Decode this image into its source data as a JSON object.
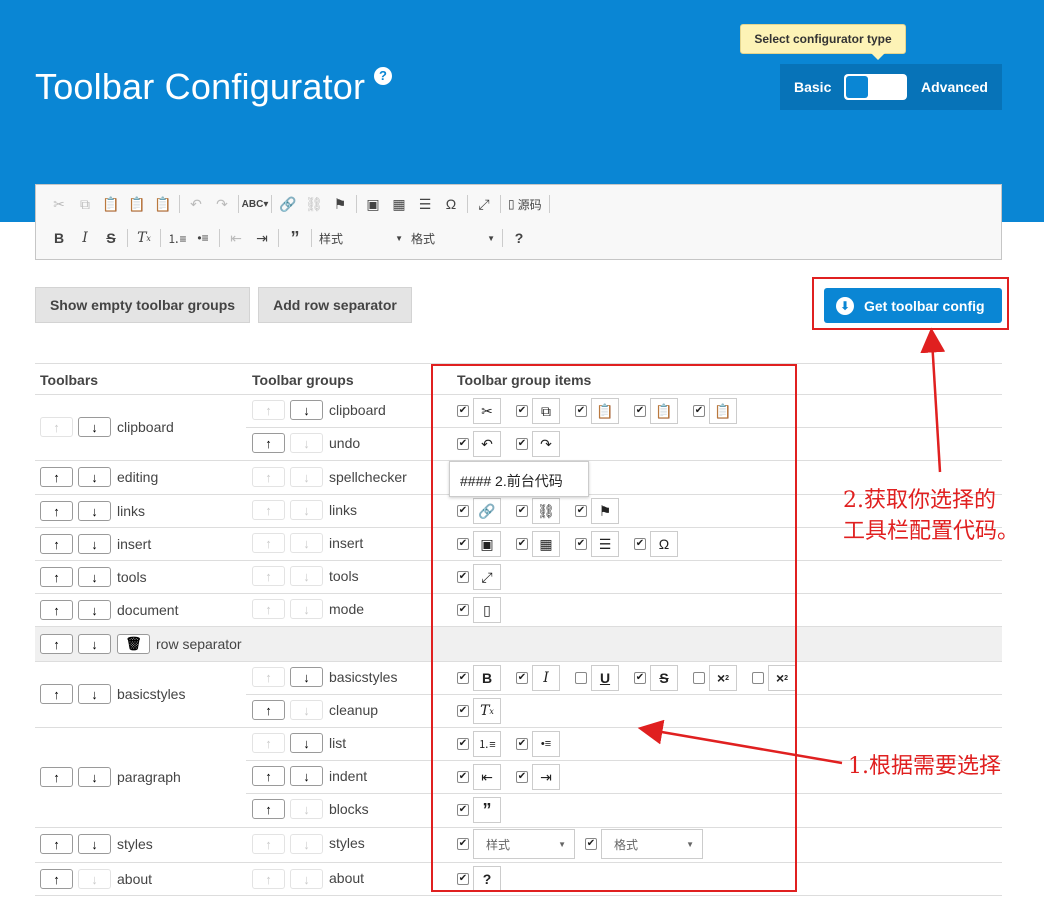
{
  "header": {
    "title": "Toolbar Configurator",
    "help_glyph": "?",
    "tooltip": "Select configurator type",
    "switch": {
      "basic_label": "Basic",
      "advanced_label": "Advanced",
      "selected": "Basic"
    },
    "colors": {
      "header_bg": "#0a86d4",
      "switch_bg": "#0773b8",
      "accent_red": "#e02020"
    }
  },
  "editor_toolbar": {
    "source_label": "源码",
    "style_combo": "样式",
    "format_combo": "格式",
    "help_glyph": "?"
  },
  "actions": {
    "show_empty": "Show empty toolbar groups",
    "add_row_sep": "Add row separator",
    "get_config": "Get toolbar config"
  },
  "table": {
    "headers": [
      "Toolbars",
      "Toolbar groups",
      "Toolbar group items"
    ],
    "toolbars": [
      "clipboard",
      "editing",
      "links",
      "insert",
      "tools",
      "document",
      "row separator",
      "basicstyles",
      "paragraph",
      "styles",
      "about"
    ],
    "groups": [
      "clipboard",
      "undo",
      "spellchecker",
      "links",
      "insert",
      "tools",
      "mode",
      "basicstyles",
      "cleanup",
      "list",
      "indent",
      "blocks",
      "styles",
      "about"
    ],
    "style_combo": "样式",
    "format_combo": "格式"
  },
  "popup_tip": "#### 2.前台代码",
  "annotations": {
    "step2_line1": "2.获取你选择的",
    "step2_line2": "工具栏配置代码。",
    "step1": "1.根据需要选择"
  }
}
